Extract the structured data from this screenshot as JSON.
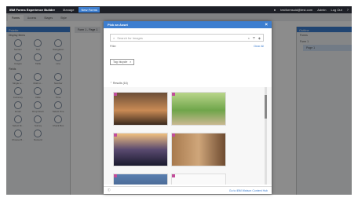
{
  "topbar": {
    "brand": "IBM Forms Experience Builder",
    "menus": [
      "Manage",
      "New Forms"
    ],
    "active_index": 1,
    "user": "testformsuid@test.com",
    "admin": "Admin",
    "logout": "Log Out"
  },
  "subbar": {
    "tabs": [
      "Forms",
      "Access",
      "Stages",
      "Style"
    ]
  },
  "palette": {
    "title": "Palette",
    "section1": "Display Items",
    "items1": [
      "Section",
      "Text",
      "Navigation",
      "Images",
      "Table",
      "Line"
    ],
    "section2": "Fields",
    "items2": [
      "Single Li...",
      "Multi Li...",
      "Number",
      "Currency",
      "Date",
      "Time",
      "Email",
      "Drop Down",
      "Select One",
      "Select M...",
      "Survey",
      "Check Box",
      "Choose B...",
      "Numeric"
    ]
  },
  "center": {
    "tab": "Form 1 - Page 1"
  },
  "outline": {
    "title": "Outline",
    "root": "Forms",
    "form": "Form 1",
    "page": "Page 1"
  },
  "modal": {
    "title": "Pick an Asset",
    "search_placeholder": "Search for Images",
    "filter_label": "Filter",
    "clear_all": "Clear All",
    "chip": "Tag: bicycle",
    "results": "Results (16)",
    "footer_link": "Go to IBM Watson Content Hub",
    "colors": {
      "accent": "#3d7ecf",
      "corner": "#c24d9a"
    }
  }
}
